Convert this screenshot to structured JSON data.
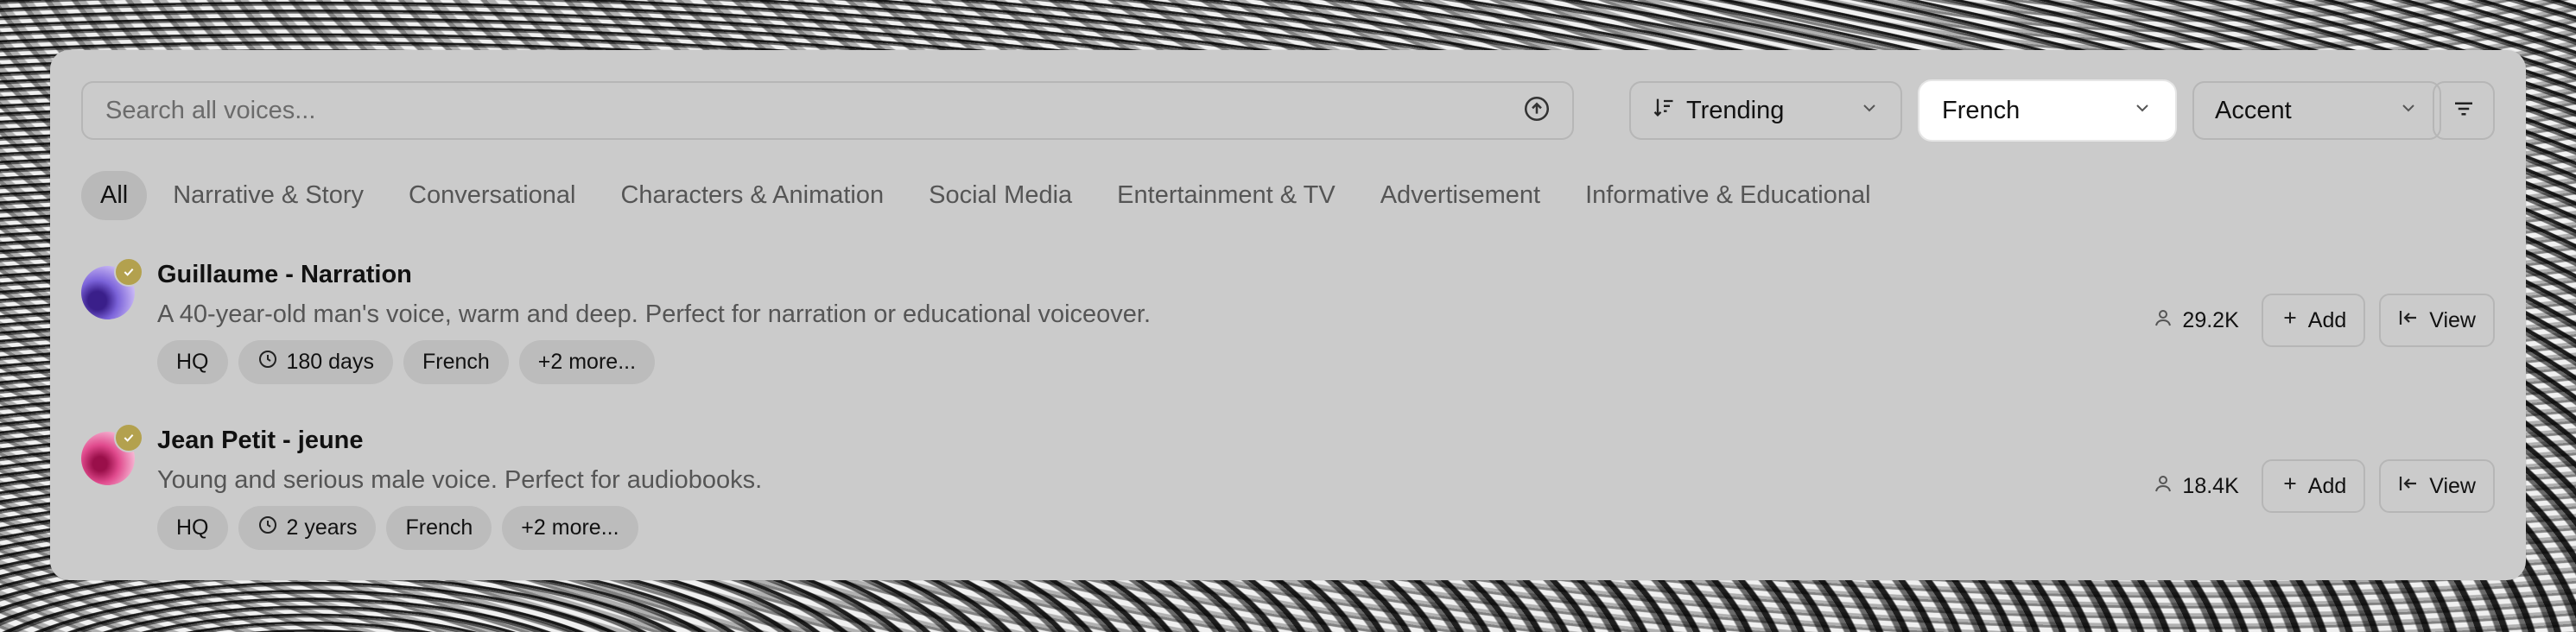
{
  "search": {
    "placeholder": "Search all voices..."
  },
  "filters": {
    "sort": "Trending",
    "language": "French",
    "accent": "Accent"
  },
  "tabs": [
    "All",
    "Narrative & Story",
    "Conversational",
    "Characters & Animation",
    "Social Media",
    "Entertainment & TV",
    "Advertisement",
    "Informative & Educational"
  ],
  "voices": [
    {
      "name": "Guillaume - Narration",
      "description": "A 40-year-old man's voice, warm and deep. Perfect for narration or educational voiceover.",
      "chips": {
        "quality": "HQ",
        "age": "180 days",
        "language": "French",
        "more": "+2 more..."
      },
      "count": "29.2K",
      "add_label": "Add",
      "view_label": "View"
    },
    {
      "name": "Jean Petit - jeune",
      "description": "Young and serious male voice. Perfect for audiobooks.",
      "chips": {
        "quality": "HQ",
        "age": "2 years",
        "language": "French",
        "more": "+2 more..."
      },
      "count": "18.4K",
      "add_label": "Add",
      "view_label": "View"
    }
  ],
  "colors": {
    "panel": "#cbcbcb",
    "badge": "#b3a14e",
    "active_dropdown": "#ffffff"
  }
}
